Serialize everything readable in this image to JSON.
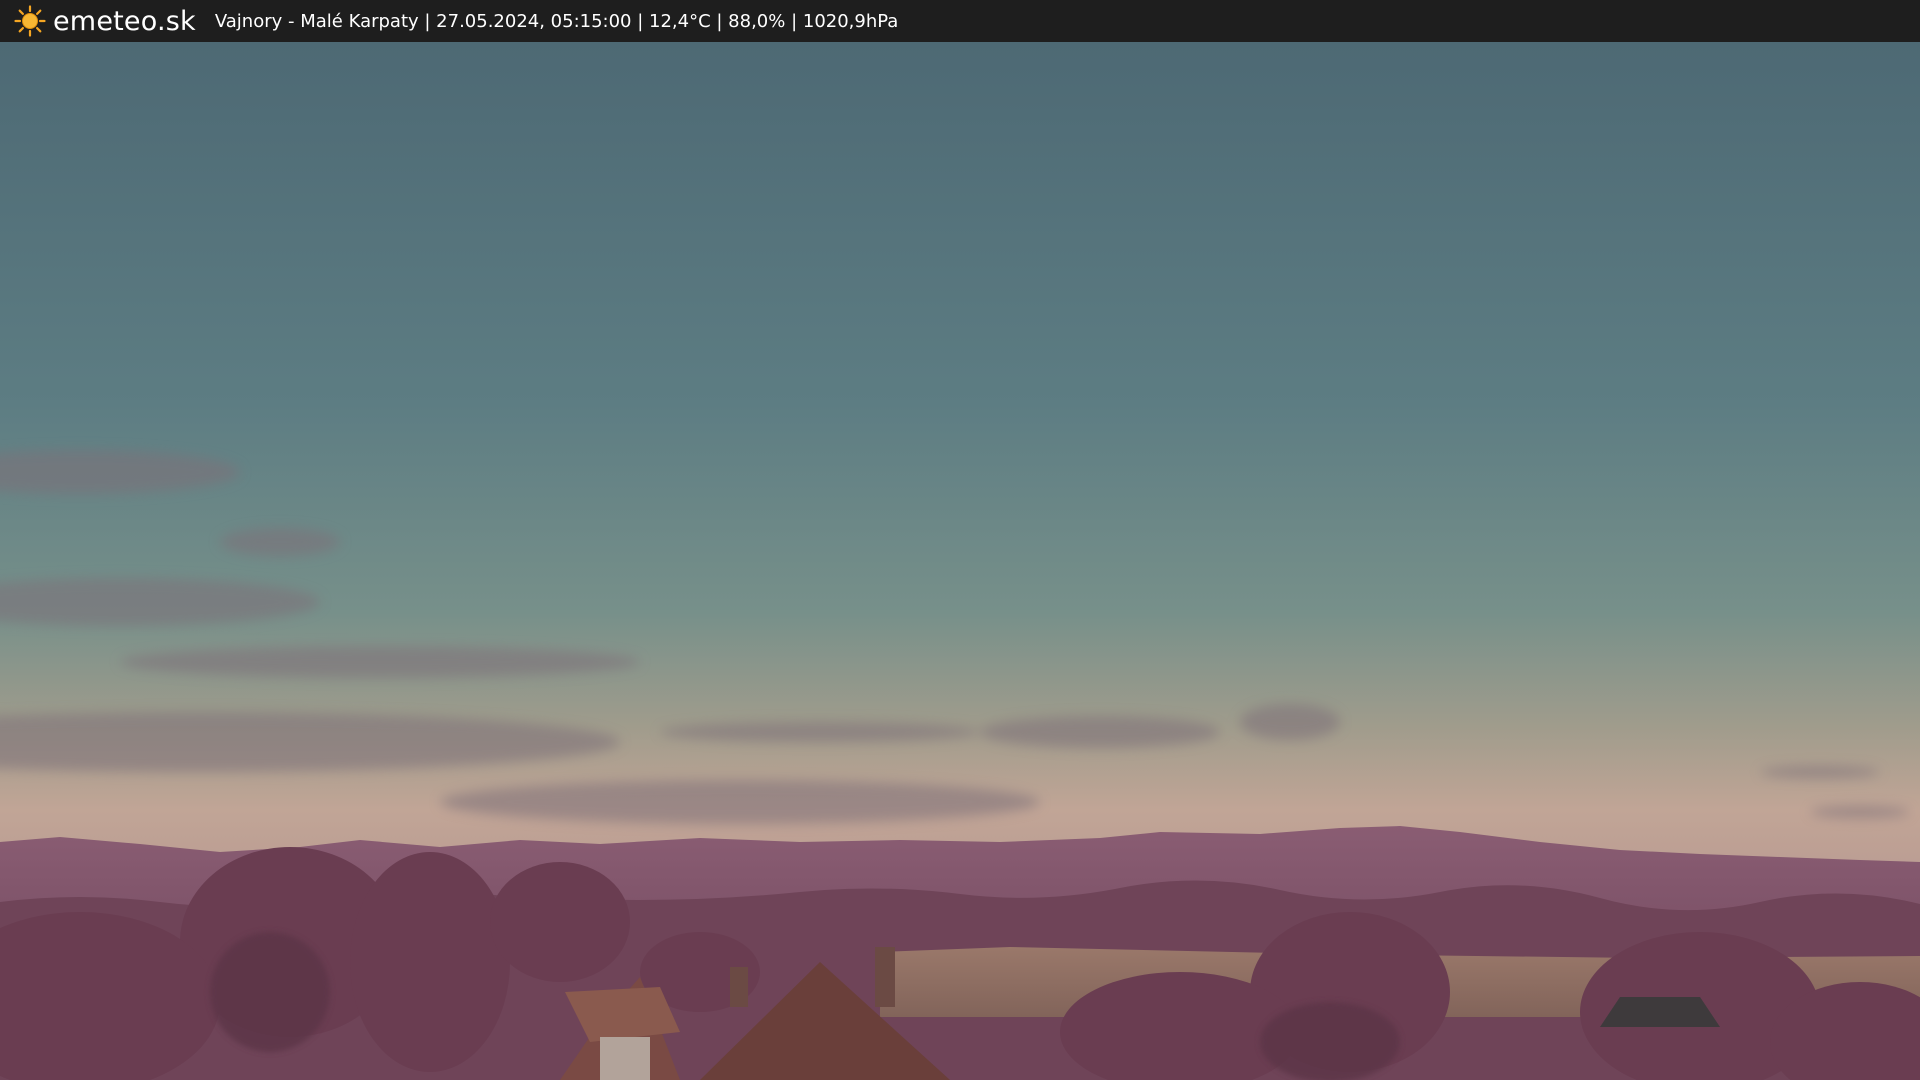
{
  "header": {
    "site_name": "emeteo.sk",
    "logo_icon": "sun-icon",
    "station_info": "Vajnory - Malé Karpaty | 27.05.2024, 05:15:00 | 12,4°C | 88,0% | 1020,9hPa"
  },
  "colors": {
    "topbar_bg": "#1e1e1e",
    "sun_orange": "#f5a623",
    "sky_top": "#4e6b76",
    "sky_mid": "#6f8a88",
    "sky_horizon": "#c6a69a",
    "hills": "#7a4f66",
    "trees": "#6b3e52"
  }
}
